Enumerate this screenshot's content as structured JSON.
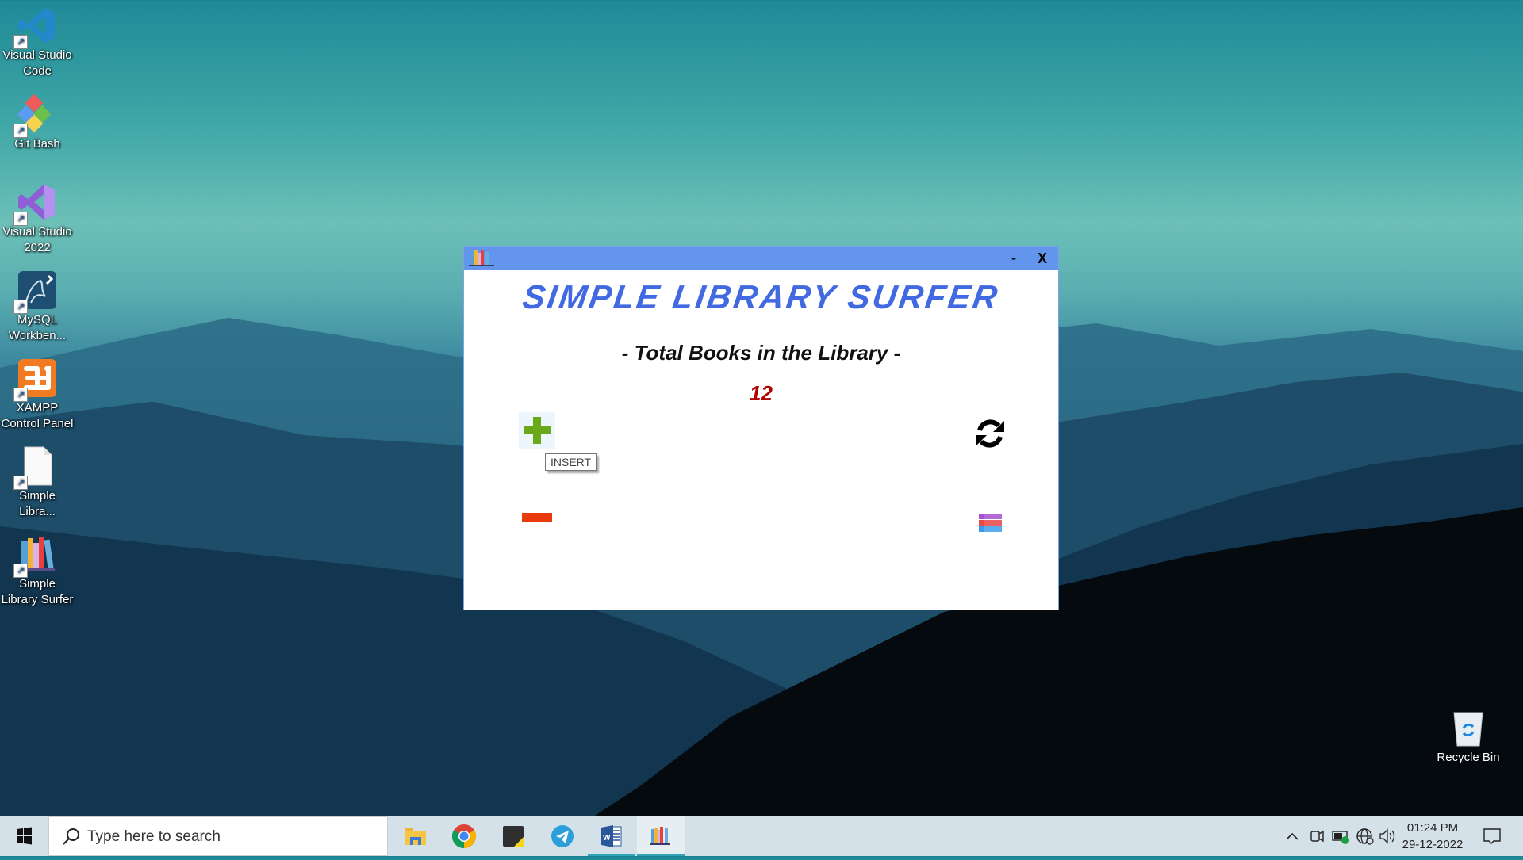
{
  "desktop": {
    "icons": [
      {
        "label": "Visual Studio Code",
        "icon": "vscode-icon"
      },
      {
        "label": "Git Bash",
        "icon": "git-bash-icon"
      },
      {
        "label": "Visual Studio 2022",
        "icon": "visual-studio-icon"
      },
      {
        "label": "MySQL Workben...",
        "icon": "mysql-workbench-icon"
      },
      {
        "label": "XAMPP Control Panel",
        "icon": "xampp-icon"
      },
      {
        "label": "Simple Libra...",
        "icon": "file-icon"
      },
      {
        "label": "Simple Library Surfer",
        "icon": "library-books-icon"
      }
    ],
    "recycle_bin": {
      "label": "Recycle Bin"
    }
  },
  "window": {
    "title_icon": "library-books-icon",
    "minimize_label": "-",
    "close_label": "X",
    "app_title": "Simple Library Surfer",
    "subtitle": "- Total Books in the Library -",
    "total_books": "12",
    "buttons": {
      "insert": {
        "icon": "plus-icon",
        "tooltip": "INSERT",
        "color": "#6aaa1a"
      },
      "delete": {
        "icon": "minus-icon",
        "color": "#e83a0c"
      },
      "refresh": {
        "icon": "refresh-icon"
      },
      "list": {
        "icon": "table-list-icon"
      }
    },
    "colors": {
      "titlebar": "#6495ed",
      "title_text": "#4169e1",
      "count_text": "#b00000"
    }
  },
  "taskbar": {
    "search_placeholder": "Type here to search",
    "apps": [
      {
        "name": "File Explorer",
        "icon": "folder-icon"
      },
      {
        "name": "Google Chrome",
        "icon": "chrome-icon"
      },
      {
        "name": "Sticky Notes",
        "icon": "sticky-notes-icon"
      },
      {
        "name": "Telegram",
        "icon": "telegram-icon"
      },
      {
        "name": "Microsoft Word",
        "icon": "word-icon"
      },
      {
        "name": "Simple Library Surfer",
        "icon": "library-books-icon"
      }
    ],
    "tray": {
      "time": "01:24 PM",
      "date": "29-12-2022"
    }
  }
}
